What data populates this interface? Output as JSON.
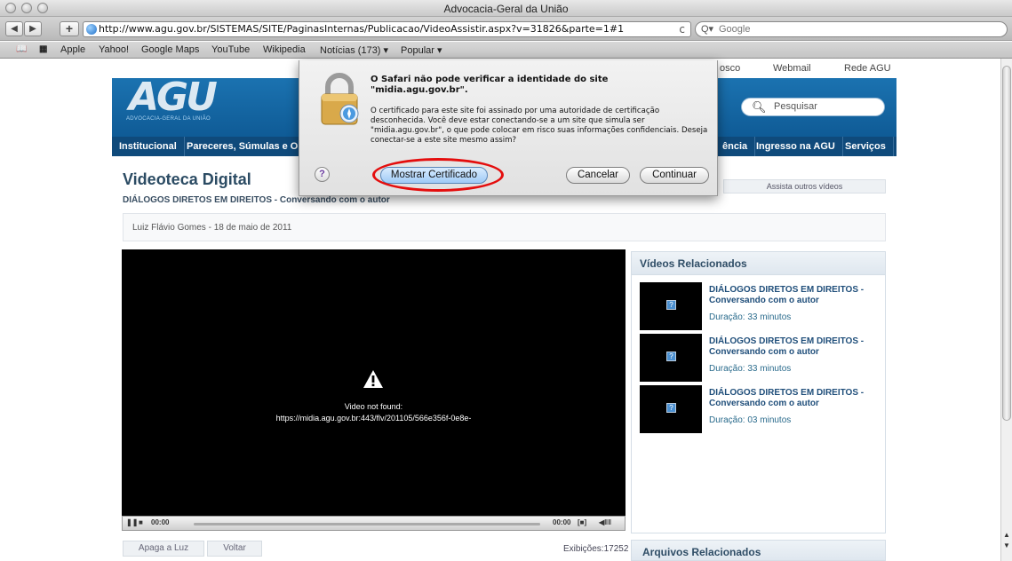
{
  "window": {
    "title": "Advocacia-Geral da União"
  },
  "toolbar": {
    "back": "◀",
    "forward": "▶",
    "add": "+",
    "url": "http://www.agu.gov.br/SISTEMAS/SITE/PaginasInternas/Publicacao/VideoAssistir.aspx?v=31826&parte=1#1",
    "reload": "c",
    "search_placeholder": "Google",
    "search_prefix": "Q▾"
  },
  "bookmarks": [
    "Apple",
    "Yahoo!",
    "Google Maps",
    "YouTube",
    "Wikipedia",
    "Notícias (173) ▾",
    "Popular ▾"
  ],
  "site": {
    "top_links": [
      "osco",
      "Webmail",
      "Rede AGU"
    ],
    "logo": "AGU",
    "logo_sub": "ADVOCACIA-GERAL DA UNIÃO",
    "search_placeholder": "Pesquisar",
    "nav": [
      "Institucional",
      "Pareceres, Súmulas e Or",
      "ência",
      "Ingresso na AGU",
      "Serviços"
    ]
  },
  "page": {
    "title": "Videoteca Digital",
    "subtitle": "DIÁLOGOS DIRETOS EM DIREITOS - Conversando com o autor",
    "outros": "Assista outros vídeos",
    "author": "Luiz Flávio Gomes - 18 de maio de 2011"
  },
  "player": {
    "message_title": "Video not found:",
    "message_url": "https://midia.agu.gov.br:443/flv/201105/566e356f-0e8e-",
    "time_start": "00:00",
    "time_end": "00:00"
  },
  "buttons": {
    "apaga": "Apaga a Luz",
    "voltar": "Voltar"
  },
  "exibicoes": "Exibições:17252",
  "related": {
    "heading": "Vídeos Relacionados",
    "items": [
      {
        "title": "DIÁLOGOS DIRETOS EM DIREITOS - Conversando com o autor",
        "duration_label": "Duração:",
        "duration": "33 minutos"
      },
      {
        "title": "DIÁLOGOS DIRETOS EM DIREITOS - Conversando com o autor",
        "duration_label": "Duração:",
        "duration": "33 minutos"
      },
      {
        "title": "DIÁLOGOS DIRETOS EM DIREITOS - Conversando com o autor",
        "duration_label": "Duração:",
        "duration": "03 minutos"
      }
    ]
  },
  "arquivos": "Arquivos Relacionados",
  "dialog": {
    "title": "O Safari não pode verificar a identidade do site \"midia.agu.gov.br\".",
    "body": "O certificado para este site foi assinado por uma autoridade de certificação desconhecida. Você deve estar conectando-se a um site que simula ser \"midia.agu.gov.br\", o que pode colocar em risco suas informações confidenciais. Deseja conectar-se a este site mesmo assim?",
    "help": "?",
    "show_cert": "Mostrar Certificado",
    "cancel": "Cancelar",
    "continue": "Continuar"
  },
  "colors": {
    "highlight": "#e40d0d",
    "header_blue": "#1f7ab9",
    "nav_blue": "#0f4a7b"
  }
}
